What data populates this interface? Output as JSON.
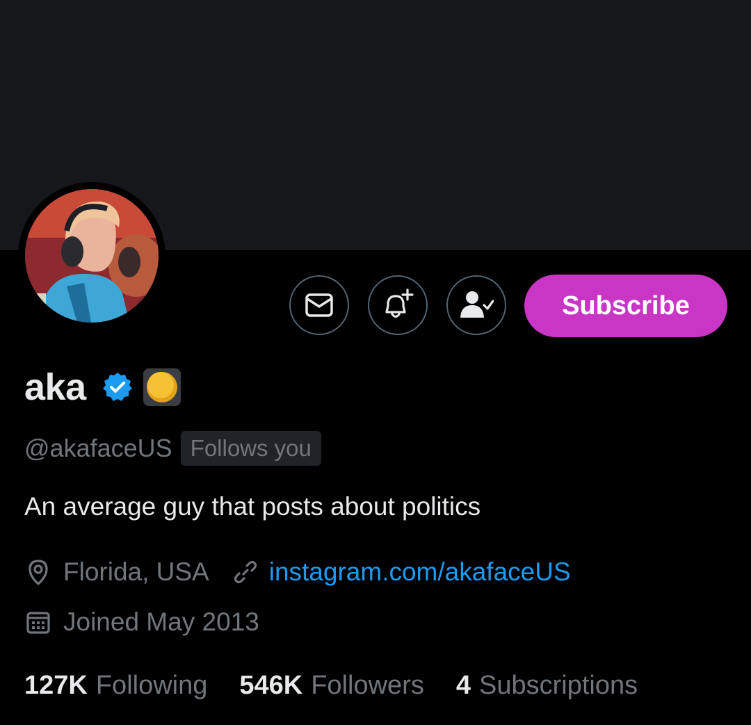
{
  "profile": {
    "display_name": "aka",
    "handle": "@akafaceUS",
    "follows_you_label": "Follows you",
    "bio": "An average guy that posts about politics",
    "location": "Florida, USA",
    "website": "instagram.com/akafaceUS",
    "joined": "Joined May 2013"
  },
  "actions": {
    "subscribe_label": "Subscribe",
    "message_icon": "envelope-icon",
    "notify_icon": "bell-plus-icon",
    "following_icon": "person-check-icon"
  },
  "stats": {
    "following_count": "127K",
    "following_label": "Following",
    "followers_count": "546K",
    "followers_label": "Followers",
    "subscriptions_count": "4",
    "subscriptions_label": "Subscriptions"
  },
  "colors": {
    "background": "#000000",
    "banner": "#16171a",
    "subscribe": "#c936c6",
    "link": "#1d9bf0",
    "verified": "#1d9bf0",
    "muted_text": "#71767b",
    "primary_text": "#e7e9ea"
  }
}
